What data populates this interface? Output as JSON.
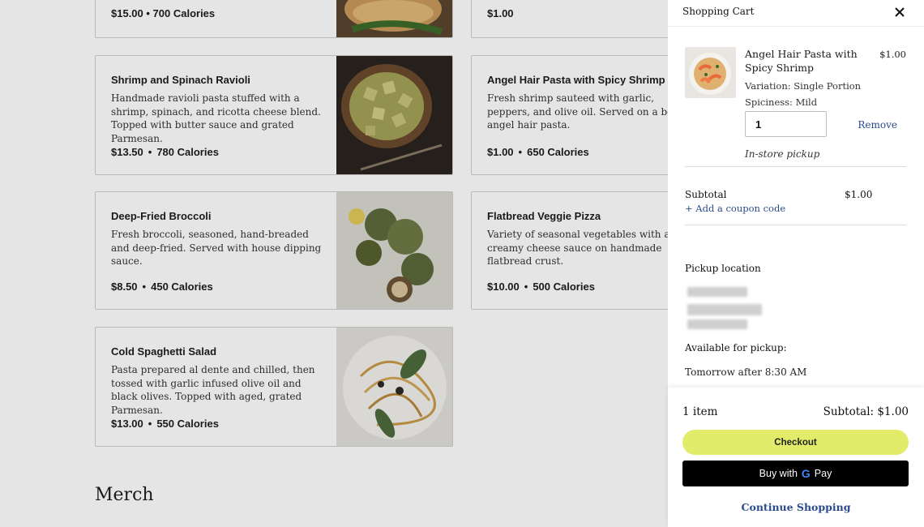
{
  "menu": {
    "top_cards": [
      {
        "price_line": "$15.00  •  700 Calories"
      },
      {
        "price_line": "$1.00"
      }
    ],
    "cards": [
      {
        "name": "Shrimp and Spinach Ravioli",
        "description": "Handmade ravioli pasta stuffed with a shrimp, spinach, and ricotta cheese blend. Topped with butter sauce and grated Parmesan.",
        "price": "$13.50",
        "calories": "780 Calories"
      },
      {
        "name": "Angel Hair Pasta with Spicy Shrimp",
        "description": "Fresh shrimp sauteed with garlic, peppers, and olive oil. Served on a bed of angel hair pasta.",
        "price": "$1.00",
        "calories": "650 Calories"
      },
      {
        "name": "Deep-Fried Broccoli",
        "description": "Fresh broccoli, seasoned, hand-breaded and deep-fried. Served with house dipping sauce.",
        "price": "$8.50",
        "calories": "450 Calories"
      },
      {
        "name": "Flatbread Veggie Pizza",
        "description": "Variety of seasonal vegetables with a creamy cheese sauce on handmade flatbread crust.",
        "price": "$10.00",
        "calories": "500 Calories"
      },
      {
        "name": "Cold Spaghetti Salad",
        "description": "Pasta prepared al dente and chilled, then tossed with garlic infused olive oil and black olives. Topped with aged, grated Parmesan.",
        "price": "$13.00",
        "calories": "550 Calories"
      }
    ],
    "section_title": "Merch"
  },
  "cart": {
    "title": "Shopping Cart",
    "item": {
      "name": "Angel Hair Pasta with Spicy Shrimp",
      "price": "$1.00",
      "variation": "Variation: Single Portion",
      "spiciness": "Spiciness: Mild",
      "quantity": "1",
      "remove_label": "Remove",
      "fulfillment": "In-store pickup"
    },
    "subtotal_label": "Subtotal",
    "subtotal_value": "$1.00",
    "coupon_label": "+ Add a coupon code",
    "pickup_location_label": "Pickup location",
    "available_label": "Available for pickup:",
    "available_value": "Tomorrow after 8:30 AM",
    "footer": {
      "item_count": "1 item",
      "subtotal": "Subtotal: $1.00",
      "checkout_label": "Checkout",
      "buy_with_label": "Buy with",
      "pay_label": "Pay",
      "continue_label": "Continue Shopping"
    }
  },
  "colors": {
    "checkout": "#e3ec6a",
    "link": "#2a4a8a"
  }
}
